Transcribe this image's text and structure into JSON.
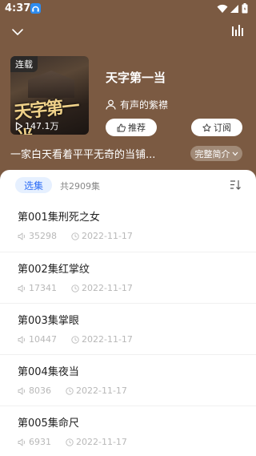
{
  "status_bar": {
    "time": "4:37"
  },
  "book": {
    "cover_tag": "连载",
    "cover_art_title": "天字第一当",
    "play_count": "147.1万",
    "title": "天字第一当",
    "author": "有声的紫襟",
    "intro": "一家白天看着平平无奇的当铺..."
  },
  "buttons": {
    "recommend": "推荐",
    "subscribe": "订阅",
    "full_intro": "完整简介"
  },
  "list": {
    "tab_label": "选集",
    "episode_count": "共2909集",
    "episodes": [
      {
        "title": "第001集刑死之女",
        "plays": "35298",
        "date": "2022-11-17"
      },
      {
        "title": "第002集红掌纹",
        "plays": "17341",
        "date": "2022-11-17"
      },
      {
        "title": "第003集掌眼",
        "plays": "10447",
        "date": "2022-11-17"
      },
      {
        "title": "第004集夜当",
        "plays": "8036",
        "date": "2022-11-17"
      },
      {
        "title": "第005集命尺",
        "plays": "6931",
        "date": "2022-11-17"
      }
    ]
  },
  "colors": {
    "header": "#7b5a42",
    "accent": "#2d6df6"
  }
}
